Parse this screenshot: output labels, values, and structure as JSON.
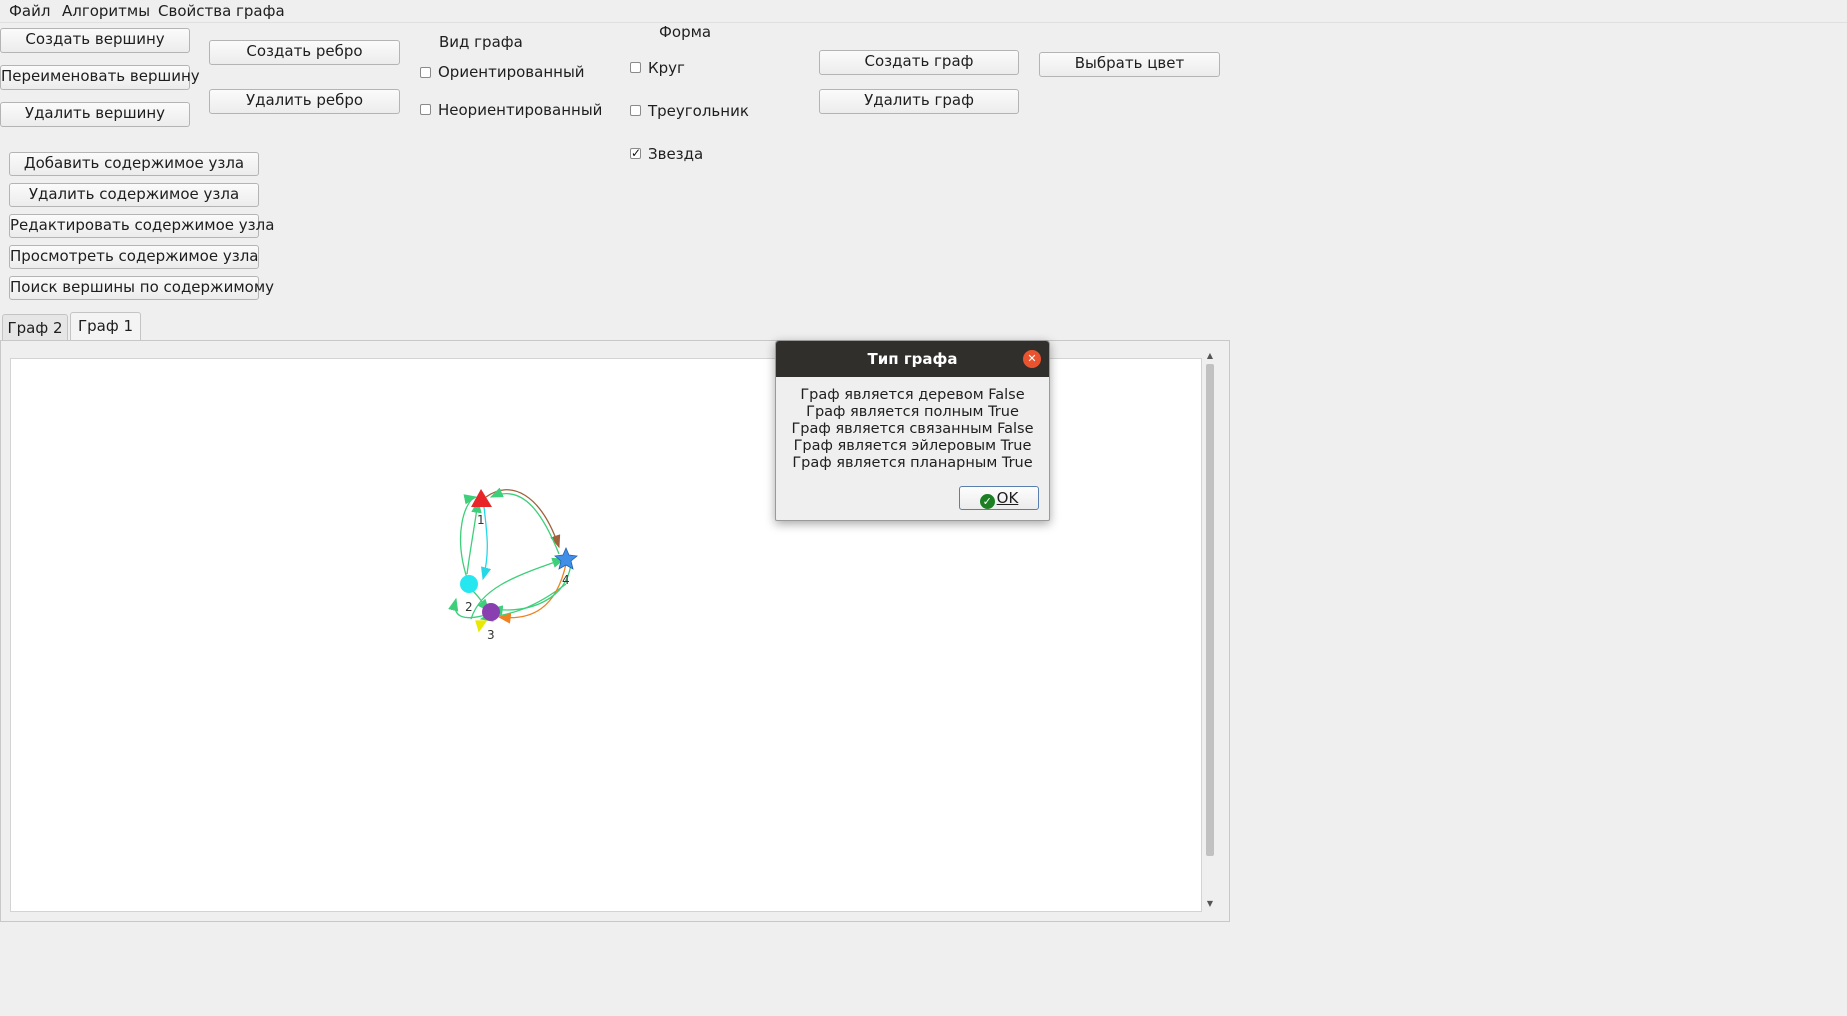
{
  "menubar": {
    "items": [
      "Файл",
      "Алгоритмы",
      "Свойства графа"
    ]
  },
  "vertex_buttons": {
    "create": "Создать вершину",
    "rename": "Переименовать вершину",
    "delete": "Удалить вершину"
  },
  "edge_buttons": {
    "create": "Создать ребро",
    "delete": "Удалить ребро"
  },
  "graph_kind": {
    "title": "Вид графа",
    "options": [
      {
        "label": "Ориентированный",
        "checked": false
      },
      {
        "label": "Неориентированный",
        "checked": false
      }
    ]
  },
  "shape": {
    "title": "Форма",
    "options": [
      {
        "label": "Круг",
        "checked": false
      },
      {
        "label": "Треугольник",
        "checked": false
      },
      {
        "label": "Звезда",
        "checked": true
      }
    ]
  },
  "graph_buttons": {
    "create": "Создать граф",
    "delete": "Удалить граф",
    "color": "Выбрать цвет"
  },
  "node_content_buttons": [
    "Добавить содержимое узла",
    "Удалить содержимое узла",
    "Редактировать содержимое узла",
    "Просмотреть содержимое узла",
    "Поиск вершины по содержимому"
  ],
  "tabs": [
    {
      "label": "Граф 2",
      "active": false
    },
    {
      "label": "Граф 1",
      "active": true
    }
  ],
  "graph": {
    "vertex_labels": [
      "1",
      "2",
      "3",
      "4"
    ],
    "colors": {
      "v1": "#e8262a",
      "v2": "#26e6f0",
      "v3": "#8a3fb0",
      "v4": "#3f8fe8",
      "edge_green": "#3dcf7a",
      "edge_cyan": "#26d8e6",
      "edge_brown": "#a0603a",
      "edge_orange": "#f08020",
      "edge_yellow": "#e8e800"
    }
  },
  "dialog": {
    "title": "Тип графа",
    "lines": [
      "Граф является деревом False",
      "Граф является полным True",
      "Граф является связанным False",
      "Граф является эйлеровым True",
      "Граф является планарным True"
    ],
    "ok_label": "OK"
  }
}
